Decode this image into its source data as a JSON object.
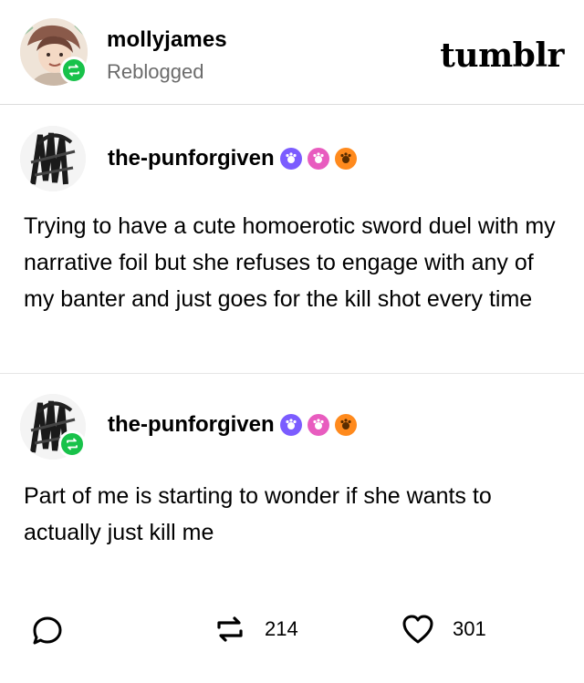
{
  "header": {
    "username": "mollyjames",
    "status": "Reblogged",
    "logo": "tumblr",
    "avatar_icon": "illustrated-avatar",
    "badge_icon": "reblog-icon"
  },
  "posts": [
    {
      "author": "the-punforgiven",
      "avatar_icon": "sketch-avatar",
      "badges": [
        "purple-badge-icon",
        "pink-badge-icon",
        "orange-badge-icon"
      ],
      "text": "Trying to have a cute homoerotic sword duel with my narrative foil but she refuses to engage with any of my banter and just goes for the kill shot every time"
    },
    {
      "author": "the-punforgiven",
      "avatar_icon": "sketch-avatar",
      "badges": [
        "purple-badge-icon",
        "pink-badge-icon",
        "orange-badge-icon"
      ],
      "text": "Part of me is starting to wonder if she wants to actually just kill me"
    }
  ],
  "footer": {
    "reblog_count": "214",
    "like_count": "301"
  },
  "colors": {
    "reblog_green": "#18c24a",
    "badge_purple": "#7b5cff",
    "badge_pink": "#e85cbf",
    "badge_orange": "#ff8a1d"
  }
}
